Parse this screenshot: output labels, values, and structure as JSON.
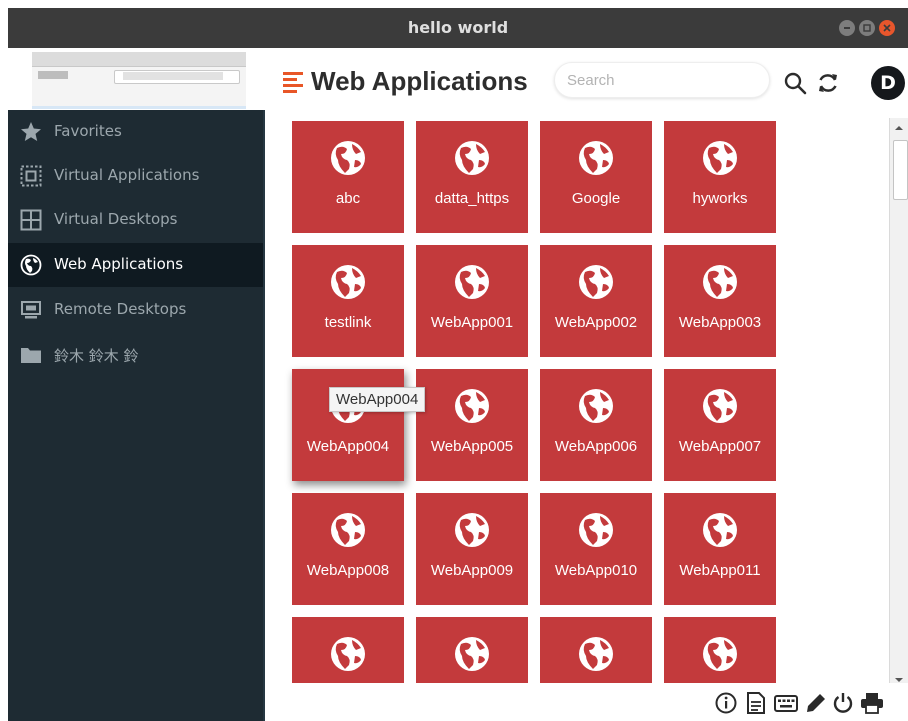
{
  "window": {
    "title": "hello world"
  },
  "header": {
    "title": "Web Applications",
    "search_placeholder": "Search",
    "avatar_letter": "D"
  },
  "sidebar": {
    "items": [
      {
        "label": "Favorites",
        "icon": "star-icon",
        "active": false
      },
      {
        "label": "Virtual Applications",
        "icon": "virtual-apps-icon",
        "active": false
      },
      {
        "label": "Virtual Desktops",
        "icon": "windows-grid-icon",
        "active": false
      },
      {
        "label": "Web Applications",
        "icon": "globe-icon",
        "active": true
      },
      {
        "label": "Remote Desktops",
        "icon": "monitor-icon",
        "active": false
      },
      {
        "label": "鈴木 鈴木 鈴",
        "icon": "folder-icon",
        "active": false
      }
    ]
  },
  "apps": [
    "abc",
    "datta_https",
    "Google",
    "hyworks",
    "testlink",
    "WebApp001",
    "WebApp002",
    "WebApp003",
    "WebApp004",
    "WebApp005",
    "WebApp006",
    "WebApp007",
    "WebApp008",
    "WebApp009",
    "WebApp010",
    "WebApp011",
    "",
    "",
    "",
    ""
  ],
  "tooltip": "WebApp004",
  "colors": {
    "tile": "#c33a3c",
    "sidebar": "#1e2b33",
    "sidebar_active": "#0f1a21",
    "accent": "#e85627",
    "titlebar": "#3b3b3b"
  },
  "bottom_icons": [
    "info-icon",
    "document-icon",
    "keyboard-icon",
    "pen-icon",
    "power-icon",
    "printer-icon"
  ]
}
